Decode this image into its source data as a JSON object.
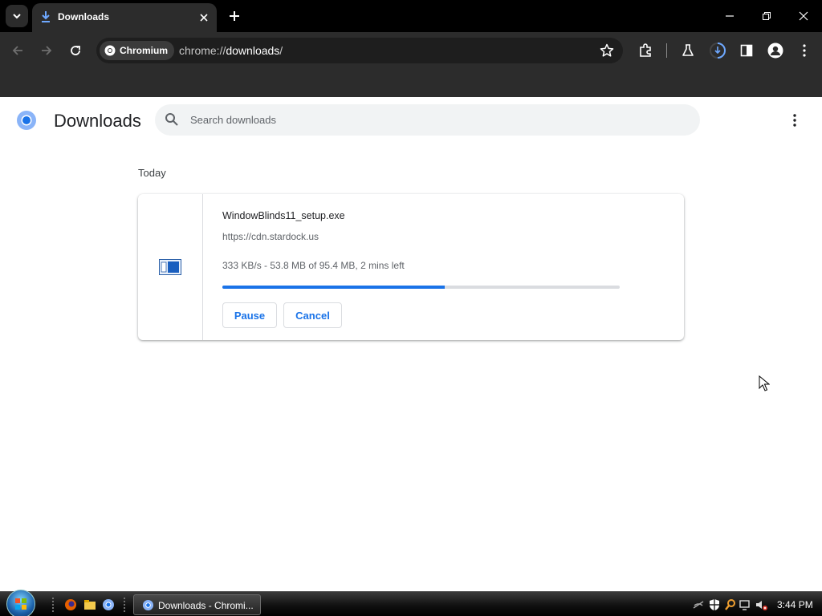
{
  "browser": {
    "tab": {
      "title": "Downloads"
    },
    "omnibox": {
      "site_chip": "Chromium",
      "url_scheme": "chrome://",
      "url_host": "downloads",
      "url_path": "/"
    }
  },
  "page": {
    "title": "Downloads",
    "search": {
      "placeholder": "Search downloads",
      "value": ""
    },
    "date_header": "Today",
    "downloads": [
      {
        "file_name": "WindowBlinds11_setup.exe",
        "source_url": "https://cdn.stardock.us",
        "status": "333 KB/s - 53.8 MB of 95.4 MB, 2 mins left",
        "progress_fraction": 0.56,
        "pause_label": "Pause",
        "cancel_label": "Cancel"
      }
    ]
  },
  "taskbar": {
    "task_button_label": "Downloads - Chromi...",
    "clock": "3:44 PM"
  },
  "colors": {
    "accent": "#1a73e8",
    "page_bg": "#ffffff",
    "toolbar_bg": "#2c2c2c",
    "tabstrip_bg": "#000000"
  }
}
